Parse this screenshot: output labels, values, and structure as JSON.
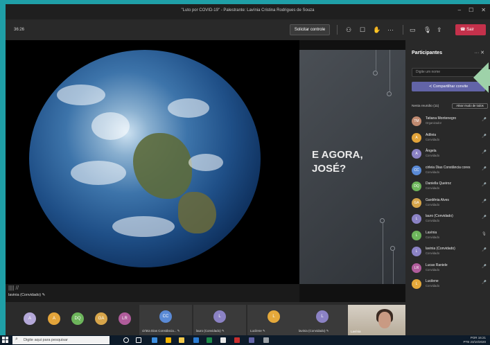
{
  "window": {
    "title": "\"Luto por COVID-19\" - Palestrante: Lavínia Cristina Rodrigues de Souza",
    "controls": [
      "–",
      "☐",
      "✕"
    ]
  },
  "toolbar": {
    "timer": "36:26",
    "request_control": "Solicitar controle",
    "leave": "Sair"
  },
  "stage": {
    "slide_text": "E AGORA,\nJOSÉ?",
    "presenter_label": "lavinia (Convidado) ✎"
  },
  "strip": {
    "avatars": [
      {
        "initials": "A",
        "color": "#b4a8d8"
      },
      {
        "initials": "A",
        "color": "#e3a43a"
      },
      {
        "initials": "DQ",
        "color": "#6db55b"
      },
      {
        "initials": "GA",
        "color": "#d7a54a"
      },
      {
        "initials": "LR",
        "color": "#b05c9b"
      }
    ],
    "tiles": [
      {
        "initials": "CC",
        "color": "#5a8ad6",
        "name": "cirleia Dias Constância... ✎"
      },
      {
        "initials": "L",
        "color": "#8b82c4",
        "name": "lauro (Convidado) ✎"
      },
      {
        "initials": "L",
        "color": "#e5a93b",
        "name": "Lucilene ✎"
      },
      {
        "initials": "L",
        "color": "#8b82c4",
        "name": "lavinia (Convidado) ✎"
      }
    ],
    "video_name": "Lavínia"
  },
  "panel": {
    "title": "Participantes",
    "actions": "···  ✕",
    "search_placeholder": "Digite um nome",
    "share_label": "Compartilhar convite",
    "section_label": "Nesta reunião (11)",
    "mute_all": "Ativar mudo de todos",
    "people": [
      {
        "name": "Tatiana Montenegro",
        "role": "Organizador",
        "initials": "TM",
        "color": "#c08a70",
        "mic": "🎤"
      },
      {
        "name": "Adileia",
        "role": "Convidado",
        "initials": "A",
        "color": "#e3a43a",
        "mic": "🎤"
      },
      {
        "name": "Ângela",
        "role": "Convidado",
        "initials": "A",
        "color": "#8b82c4",
        "mic": "🎤"
      },
      {
        "name": "cirleia Dias Constância cores",
        "role": "Convidado",
        "initials": "CC",
        "color": "#5a8ad6",
        "mic": "🎤"
      },
      {
        "name": "Daniella Queiroz",
        "role": "Convidado",
        "initials": "DQ",
        "color": "#6db55b",
        "mic": "🎤"
      },
      {
        "name": "Gardênia Alves",
        "role": "Convidado",
        "initials": "GA",
        "color": "#d7a54a",
        "mic": "🎤"
      },
      {
        "name": "lauro (Convidado)",
        "role": "Convidado",
        "initials": "L",
        "color": "#8b82c4",
        "mic": "🎤"
      },
      {
        "name": "Lavínia",
        "role": "Convidado",
        "initials": "L",
        "color": "#6db55b",
        "mic": "🎙"
      },
      {
        "name": "lavinia (Convidado)",
        "role": "Convidado",
        "initials": "L",
        "color": "#8b82c4",
        "mic": "🎤"
      },
      {
        "name": "Lucas Raniele",
        "role": "Convidado",
        "initials": "LR",
        "color": "#b05c9b",
        "mic": "🎤"
      },
      {
        "name": "Lucilene",
        "role": "Convidado",
        "initials": "L",
        "color": "#e5a93b",
        "mic": "🎤"
      }
    ]
  },
  "taskbar": {
    "search_placeholder": "Digite aqui para pesquisar",
    "tray_line1": "POR  16:21",
    "tray_line2": "PTB  23/10/2020"
  }
}
